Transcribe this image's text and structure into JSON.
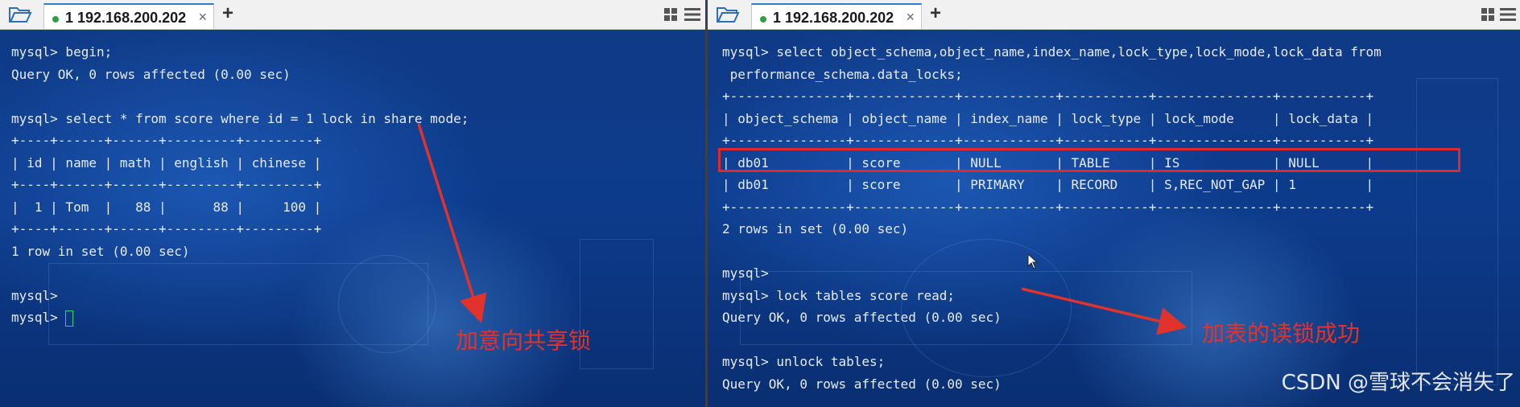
{
  "left": {
    "tab_label": "1 192.168.200.202",
    "close_glyph": "×",
    "add_glyph": "+",
    "lines": [
      "mysql> begin;",
      "Query OK, 0 rows affected (0.00 sec)",
      "",
      "mysql> select * from score where id = 1 lock in share mode;",
      "+----+------+------+---------+---------+",
      "| id | name | math | english | chinese |",
      "+----+------+------+---------+---------+",
      "|  1 | Tom  |   88 |      88 |     100 |",
      "+----+------+------+---------+---------+",
      "1 row in set (0.00 sec)",
      "",
      "mysql>",
      "mysql> "
    ],
    "annotation": "加意向共享锁"
  },
  "right": {
    "tab_label": "1 192.168.200.202",
    "close_glyph": "×",
    "add_glyph": "+",
    "lines": [
      "mysql> select object_schema,object_name,index_name,lock_type,lock_mode,lock_data from",
      " performance_schema.data_locks;",
      "+---------------+-------------+------------+-----------+---------------+-----------+",
      "| object_schema | object_name | index_name | lock_type | lock_mode     | lock_data |",
      "+---------------+-------------+------------+-----------+---------------+-----------+",
      "| db01          | score       | NULL       | TABLE     | IS            | NULL      |",
      "| db01          | score       | PRIMARY    | RECORD    | S,REC_NOT_GAP | 1         |",
      "+---------------+-------------+------------+-----------+---------------+-----------+",
      "2 rows in set (0.00 sec)",
      "",
      "mysql>",
      "mysql> lock tables score read;",
      "Query OK, 0 rows affected (0.00 sec)",
      "",
      "mysql> unlock tables;",
      "Query OK, 0 rows affected (0.00 sec)"
    ],
    "annotation": "加表的读锁成功"
  },
  "watermark": "CSDN @雪球不会消失了",
  "icons": {
    "open": "folder-open-icon",
    "layout": "layout-grid-icon",
    "menu": "hamburger-menu-icon"
  },
  "colors": {
    "terminal_text": "#e6ecf5",
    "annotation": "#e1332b",
    "tab_active": "#2d7fd3",
    "connected": "#2ea043"
  }
}
